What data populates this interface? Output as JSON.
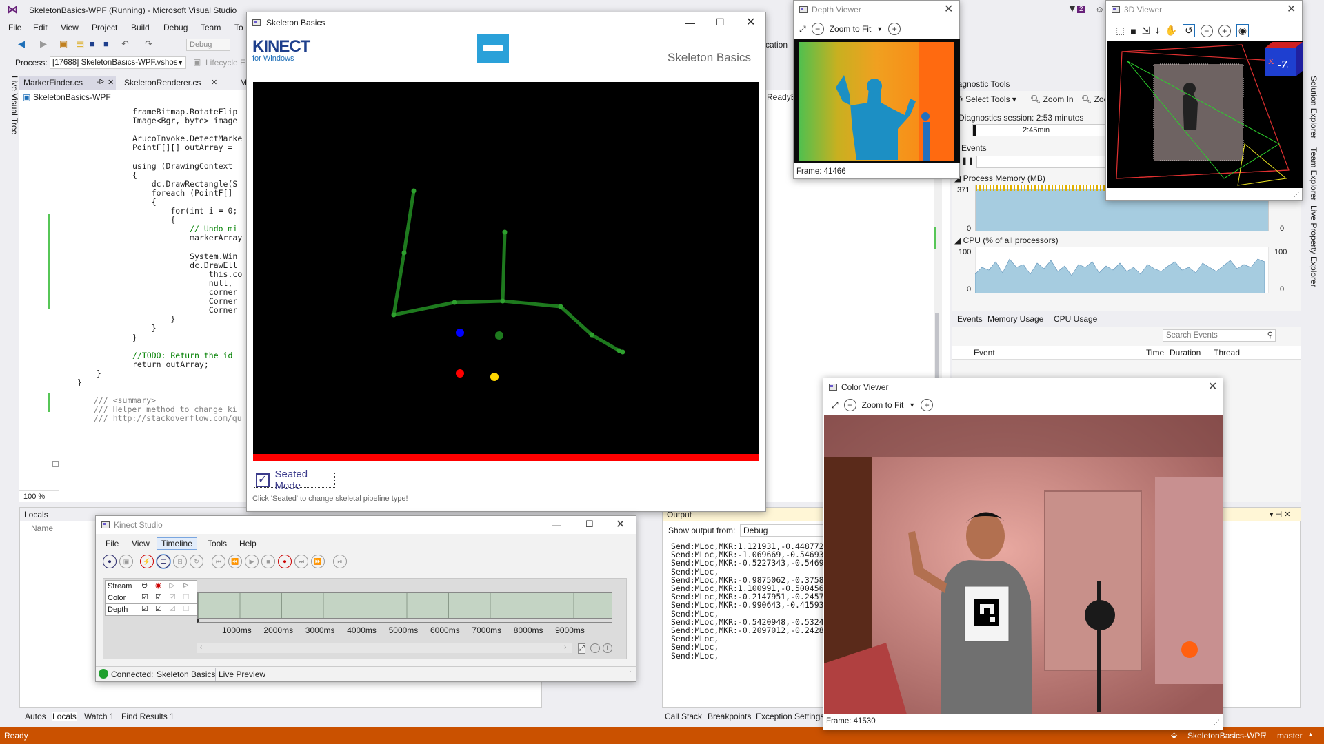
{
  "vs": {
    "title": "SkeletonBasics-WPF (Running) - Microsoft Visual Studio",
    "menu": [
      "File",
      "Edit",
      "View",
      "Project",
      "Build",
      "Debug",
      "Team",
      "To"
    ],
    "toolbar": {
      "config": "Debug"
    },
    "notif_count": "2",
    "process_label": "Process:",
    "process_value": "[17688] SkeletonBasics-WPF.vshos",
    "lifecycle": "Lifecycle E",
    "doc_tabs": [
      "MarkerFinder.cs",
      "SkeletonRenderer.cs",
      "M"
    ],
    "nav_member": "SkeletonBasics-WPF",
    "zoom": "100 %",
    "left_side_tab": "Live Visual Tree",
    "right_side_tabs": [
      "Solution Explorer",
      "Team Explorer",
      "Live Property Explorer"
    ],
    "code": [
      "frameBitmap.RotateFlip",
      "Image<Bgr, byte> image",
      "",
      "ArucoInvoke.DetectMarke",
      "PointF[][] outArray = ",
      "",
      "using (DrawingContext ",
      "{",
      "    dc.DrawRectangle(S",
      "    foreach (PointF[] ",
      "    {",
      "        for(int i = 0;",
      "        {",
      "            // Undo mi",
      "            markerArray",
      "",
      "            System.Win",
      "            dc.DrawEll",
      "                this.co",
      "                null,",
      "                corner",
      "                Corner",
      "                Corner",
      "        }",
      "    }",
      "}",
      "",
      "//TODO: Return the id ",
      "return outArray;",
      "}",
      "}",
      "",
      "/// <summary>",
      "/// Helper method to change ki",
      "/// http://stackoverflow.com/qu"
    ],
    "status": "Ready",
    "status_right": [
      "SkeletonBasics-WPF",
      "master"
    ],
    "ready_tab": "ReadyE",
    "cation": "cation"
  },
  "locals": {
    "title": "Locals",
    "col_name": "Name",
    "bottom_tabs": [
      "Autos",
      "Locals",
      "Watch 1",
      "Find Results 1"
    ]
  },
  "output": {
    "title": "Output",
    "show_from_label": "Show output from:",
    "show_from_value": "Debug",
    "lines": [
      "Send:MLoc,MKR:1.121931,-0.448772",
      "Send:MLoc,MKR:-1.069669,-0.54693",
      "Send:MLoc,MKR:-0.5227343,-0.5469",
      "Send:MLoc,",
      "Send:MLoc,MKR:-0.9875062,-0.3758",
      "Send:MLoc,MKR:1.100991,-0.500456",
      "Send:MLoc,MKR:-0.2147951,-0.2457",
      "Send:MLoc,MKR:-0.990643,-0.41593",
      "Send:MLoc,",
      "Send:MLoc,MKR:-0.5420948,-0.5324",
      "Send:MLoc,MKR:-0.2097012,-0.2428",
      "Send:MLoc,",
      "Send:MLoc,",
      "Send:MLoc,"
    ],
    "bottom_tabs": [
      "Call Stack",
      "Breakpoints",
      "Exception Settings"
    ]
  },
  "diag": {
    "title": "iagnostic Tools",
    "select_tools": "Select Tools",
    "zoom_in": "Zoom In",
    "zoom_out": "Zoo",
    "session": "Diagnostics session: 2:53 minutes",
    "time_tick": "2:45min",
    "events": "Events",
    "memory_title": "Process Memory (MB)",
    "mem_max": "371",
    "mem_min": "0",
    "mem_right_min": "0",
    "cpu_title": "CPU (% of all processors)",
    "cpu_max": "100",
    "cpu_min": "0",
    "cpu_right_max": "100",
    "cpu_right_min": "0",
    "tabs": [
      "Events",
      "Memory Usage",
      "CPU Usage"
    ],
    "search_placeholder": "Search Events",
    "cols": [
      "Event",
      "Time",
      "Duration",
      "Thread"
    ]
  },
  "skeleton": {
    "title": "Skeleton Basics",
    "kinect": "KINECT",
    "for_windows": "for Windows",
    "heading": "Skeleton Basics",
    "seated": "Seated Mode",
    "hint": "Click 'Seated' to change skeletal pipeline type!",
    "colors": {
      "bone": "#1e7a1e",
      "joint": "#2ea02e",
      "blue": "#0000ff",
      "green": "#1e7a1e",
      "red": "#ff0000",
      "yellow": "#ffd700"
    }
  },
  "depth": {
    "title": "Depth Viewer",
    "zoom": "Zoom to Fit",
    "frame": "Frame: 41466"
  },
  "viewer3d": {
    "title": "3D Viewer",
    "axis_x": "X",
    "axis_z": "-Z"
  },
  "color": {
    "title": "Color Viewer",
    "zoom": "Zoom to Fit",
    "frame": "Frame: 41530"
  },
  "studio": {
    "title": "Kinect Studio",
    "menu": [
      "File",
      "View",
      "Timeline",
      "Tools",
      "Help"
    ],
    "rows": [
      "Stream",
      "Color",
      "Depth"
    ],
    "ticks": [
      "1000ms",
      "2000ms",
      "3000ms",
      "4000ms",
      "5000ms",
      "6000ms",
      "7000ms",
      "8000ms",
      "9000ms"
    ],
    "connected": "Connected:",
    "app": "Skeleton Basics",
    "preview": "Live Preview"
  }
}
